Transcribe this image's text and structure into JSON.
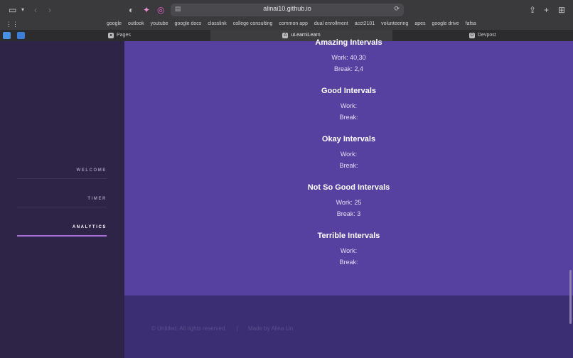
{
  "browser": {
    "url": "alinai10.github.io",
    "bookmarks": [
      "google",
      "outlook",
      "youtube",
      "google docs",
      "classlink",
      "college consulting",
      "common app",
      "dual enrollment",
      "acct2101",
      "volunteering",
      "apes",
      "google drive",
      "fafsa"
    ],
    "tabs": [
      {
        "label": "Pages",
        "favicon": "github"
      },
      {
        "label": "uLearniLearn",
        "favicon": "A"
      },
      {
        "label": "Devpost",
        "favicon": "D"
      }
    ]
  },
  "sidebar": {
    "items": [
      {
        "label": "WELCOME"
      },
      {
        "label": "TIMER"
      },
      {
        "label": "ANALYTICS"
      }
    ]
  },
  "sections": [
    {
      "title": "Amazing Intervals",
      "work": "Work: 40,30",
      "break": "Break: 2,4"
    },
    {
      "title": "Good Intervals",
      "work": "Work:",
      "break": "Break:"
    },
    {
      "title": "Okay Intervals",
      "work": "Work:",
      "break": "Break:"
    },
    {
      "title": "Not So Good Intervals",
      "work": "Work: 25",
      "break": "Break: 3"
    },
    {
      "title": "Terrible Intervals",
      "work": "Work:",
      "break": "Break:"
    }
  ],
  "footer": {
    "copyright": "© Untitled. All rights reserved.",
    "separator": "|",
    "credit": "Made by Alina Lin"
  },
  "colors": {
    "main_bg": "#5641a0",
    "sidebar_bg": "#2d2447",
    "footer_bg": "#3b2e73",
    "active_underline": "#a86fd8"
  }
}
